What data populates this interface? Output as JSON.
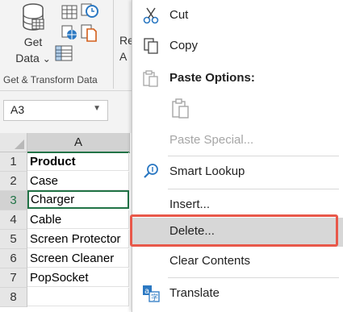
{
  "ribbon": {
    "get_data_line1": "Get",
    "get_data_line2": "Data",
    "get_data_arrow": "⌄",
    "group_label": "Get & Transform Data",
    "partial_1": "Re",
    "partial_2": "A"
  },
  "name_box": {
    "value": "A3"
  },
  "grid": {
    "column_header": "A",
    "rows": [
      {
        "num": "1",
        "value": "Product"
      },
      {
        "num": "2",
        "value": "Case"
      },
      {
        "num": "3",
        "value": "Charger"
      },
      {
        "num": "4",
        "value": "Cable"
      },
      {
        "num": "5",
        "value": "Screen Protector"
      },
      {
        "num": "6",
        "value": "Screen Cleaner"
      },
      {
        "num": "7",
        "value": "PopSocket"
      },
      {
        "num": "8",
        "value": ""
      }
    ]
  },
  "menu": {
    "cut": "Cut",
    "copy": "Copy",
    "paste_options": "Paste Options:",
    "paste_special": "Paste Special...",
    "smart_lookup": "Smart Lookup",
    "insert": "Insert...",
    "delete": "Delete...",
    "clear_contents": "Clear Contents",
    "translate": "Translate"
  },
  "colors": {
    "excel_green": "#217346",
    "highlight_red": "#e8584a",
    "hover_grey": "#d7d7d7"
  },
  "icons": [
    "database-icon",
    "table-icon",
    "clock-icon",
    "globe-icon",
    "file-icon",
    "grid-icon",
    "scissors-icon",
    "copy-icon",
    "clipboard-icon",
    "search-icon",
    "translate-icon"
  ]
}
